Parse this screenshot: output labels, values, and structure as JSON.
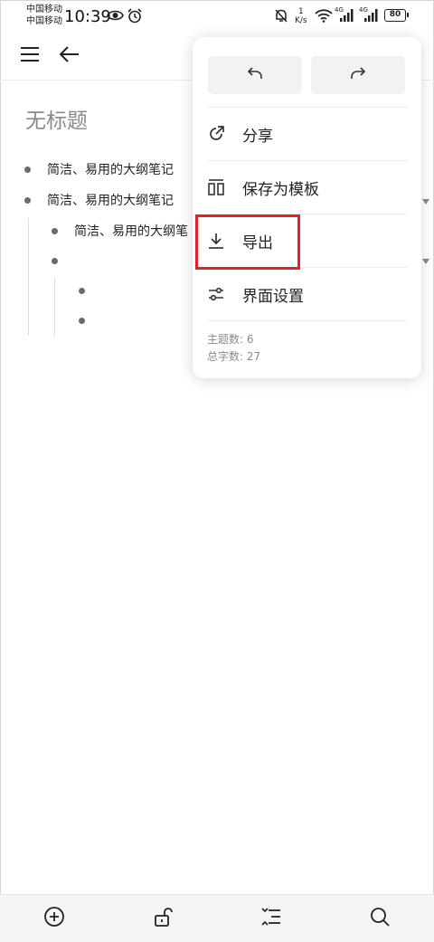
{
  "status_bar": {
    "carrier_1": "中国移动",
    "carrier_2": "中国移动",
    "time": "10:39",
    "speed_value": "1",
    "speed_unit": "K/s",
    "network_1": "4G",
    "network_2": "4G",
    "battery": "80"
  },
  "document": {
    "title": "无标题",
    "nodes": [
      {
        "text": "简洁、易用的大纲笔记",
        "level": 0
      },
      {
        "text": "简洁、易用的大纲笔记",
        "level": 0
      },
      {
        "text": "简洁、易用的大纲笔",
        "level": 1
      },
      {
        "text": "",
        "level": 1
      },
      {
        "text": "",
        "level": 2
      },
      {
        "text": "",
        "level": 2
      }
    ]
  },
  "menu": {
    "items": [
      {
        "label": "分享",
        "icon": "share-icon"
      },
      {
        "label": "保存为模板",
        "icon": "template-icon"
      },
      {
        "label": "导出",
        "icon": "export-icon"
      },
      {
        "label": "界面设置",
        "icon": "settings-sliders-icon"
      }
    ],
    "stats": {
      "topic_count": "主题数: 6",
      "char_count": "总字数: 27"
    },
    "highlighted_item": "导出",
    "highlight_color": "#e0202a"
  },
  "toolbar": {
    "icons": [
      "add-circle-icon",
      "unlock-icon",
      "outline-list-icon",
      "search-icon"
    ]
  }
}
